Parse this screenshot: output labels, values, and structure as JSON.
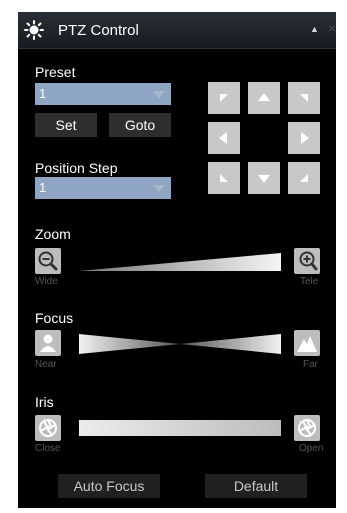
{
  "titlebar": {
    "title": "PTZ Control",
    "collapse_glyph": "▲",
    "close_glyph": "×"
  },
  "preset": {
    "label": "Preset",
    "value": "1",
    "set_label": "Set",
    "goto_label": "Goto"
  },
  "position_step": {
    "label": "Position Step",
    "value": "1"
  },
  "zoom": {
    "label": "Zoom",
    "left_caption": "Wide",
    "right_caption": "Tele"
  },
  "focus": {
    "label": "Focus",
    "left_caption": "Near",
    "right_caption": "Far"
  },
  "iris": {
    "label": "Iris",
    "left_caption": "Close",
    "right_caption": "Open"
  },
  "footer": {
    "auto_focus_label": "Auto Focus",
    "default_label": "Default"
  },
  "colors": {
    "select_bg": "#8ea6c3",
    "button_bg": "#2e2e2e",
    "dpad_bg": "#c8c8c8"
  }
}
